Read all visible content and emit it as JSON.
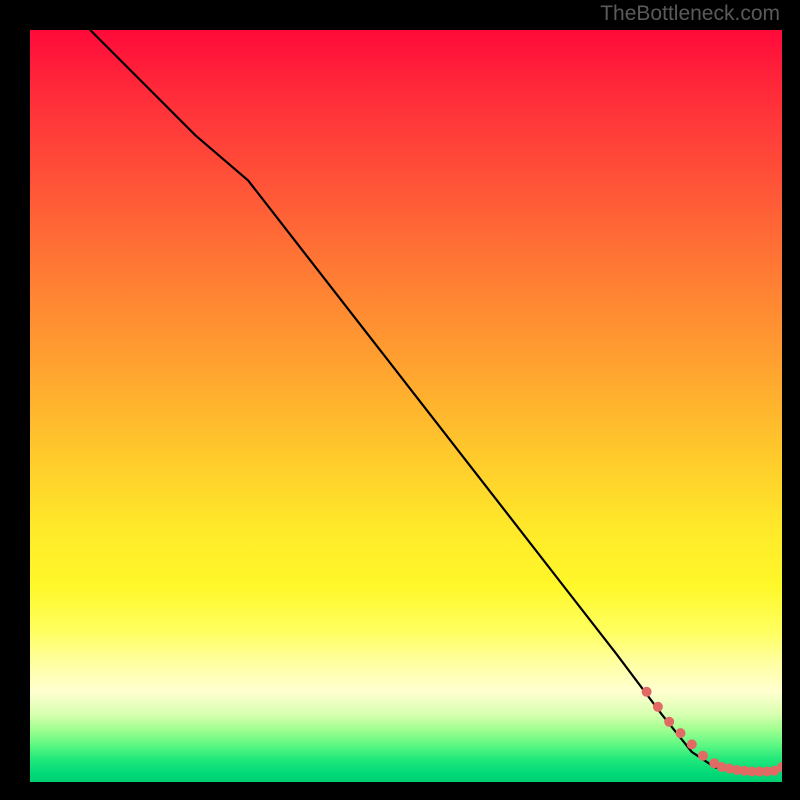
{
  "watermark": "TheBottleneck.com",
  "chart_data": {
    "type": "line",
    "title": "",
    "xlabel": "",
    "ylabel": "",
    "xlim": [
      0,
      100
    ],
    "ylim": [
      0,
      100
    ],
    "series": [
      {
        "name": "curve",
        "x": [
          8,
          15,
          22,
          29,
          36,
          43,
          50,
          57,
          64,
          71,
          78,
          84,
          88,
          91,
          93,
          95,
          97,
          99,
          100
        ],
        "y": [
          100,
          93,
          86,
          80,
          71,
          62,
          53,
          44,
          35,
          26,
          17,
          9,
          4,
          2,
          1.5,
          1.3,
          1.2,
          1.3,
          2
        ]
      }
    ],
    "scatter": {
      "name": "dots",
      "x": [
        82,
        83.5,
        85,
        86.5,
        88,
        89.5,
        91,
        92,
        93,
        94,
        95,
        96,
        97,
        98,
        99,
        100
      ],
      "y": [
        12,
        10,
        8,
        6.5,
        5,
        3.5,
        2.5,
        2,
        1.8,
        1.6,
        1.5,
        1.4,
        1.4,
        1.4,
        1.5,
        2
      ]
    },
    "colors": {
      "line": "#000000",
      "dots": "#e16a64",
      "gradient_top": "#ff0a3a",
      "gradient_mid": "#ffe82a",
      "gradient_bottom": "#00d878",
      "background": "#000000"
    }
  }
}
